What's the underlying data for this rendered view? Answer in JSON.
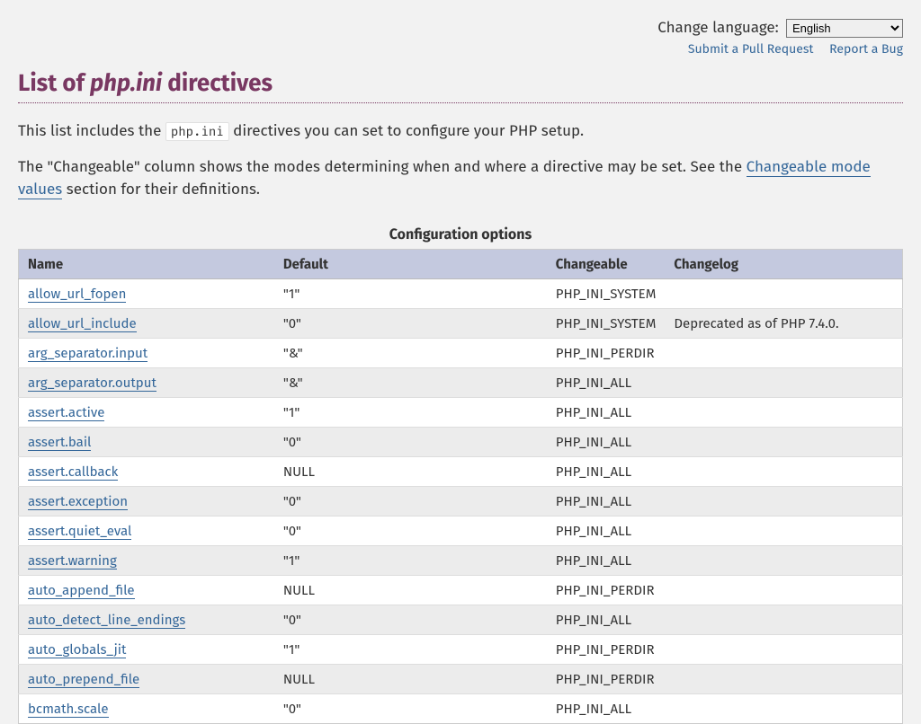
{
  "topbar": {
    "change_language_label": "Change language:",
    "selected_language": "English"
  },
  "sublinks": {
    "pull_request": "Submit a Pull Request",
    "report_bug": "Report a Bug"
  },
  "heading": {
    "prefix": "List of ",
    "emphasis": "php.ini",
    "suffix": " directives"
  },
  "intro1": {
    "before_code": "This list includes the ",
    "code": "php.ini",
    "after_code": " directives you can set to configure your PHP setup."
  },
  "intro2": {
    "before_link": "The \"Changeable\" column shows the modes determining when and where a directive may be set. See the ",
    "link": "Changeable mode values",
    "after_link": " section for their definitions."
  },
  "table": {
    "caption": "Configuration options",
    "columns": {
      "name": "Name",
      "default": "Default",
      "changeable": "Changeable",
      "changelog": "Changelog"
    },
    "rows": [
      {
        "name": "allow_url_fopen",
        "default": "\"1\"",
        "changeable": "PHP_INI_SYSTEM",
        "changelog": ""
      },
      {
        "name": "allow_url_include",
        "default": "\"0\"",
        "changeable": "PHP_INI_SYSTEM",
        "changelog": "Deprecated as of PHP 7.4.0."
      },
      {
        "name": "arg_separator.input",
        "default": "\"&\"",
        "changeable": "PHP_INI_PERDIR",
        "changelog": ""
      },
      {
        "name": "arg_separator.output",
        "default": "\"&\"",
        "changeable": "PHP_INI_ALL",
        "changelog": ""
      },
      {
        "name": "assert.active",
        "default": "\"1\"",
        "changeable": "PHP_INI_ALL",
        "changelog": ""
      },
      {
        "name": "assert.bail",
        "default": "\"0\"",
        "changeable": "PHP_INI_ALL",
        "changelog": ""
      },
      {
        "name": "assert.callback",
        "default": "NULL",
        "changeable": "PHP_INI_ALL",
        "changelog": ""
      },
      {
        "name": "assert.exception",
        "default": "\"0\"",
        "changeable": "PHP_INI_ALL",
        "changelog": ""
      },
      {
        "name": "assert.quiet_eval",
        "default": "\"0\"",
        "changeable": "PHP_INI_ALL",
        "changelog": ""
      },
      {
        "name": "assert.warning",
        "default": "\"1\"",
        "changeable": "PHP_INI_ALL",
        "changelog": ""
      },
      {
        "name": "auto_append_file",
        "default": "NULL",
        "changeable": "PHP_INI_PERDIR",
        "changelog": ""
      },
      {
        "name": "auto_detect_line_endings",
        "default": "\"0\"",
        "changeable": "PHP_INI_ALL",
        "changelog": ""
      },
      {
        "name": "auto_globals_jit",
        "default": "\"1\"",
        "changeable": "PHP_INI_PERDIR",
        "changelog": ""
      },
      {
        "name": "auto_prepend_file",
        "default": "NULL",
        "changeable": "PHP_INI_PERDIR",
        "changelog": ""
      },
      {
        "name": "bcmath.scale",
        "default": "\"0\"",
        "changeable": "PHP_INI_ALL",
        "changelog": ""
      }
    ]
  }
}
